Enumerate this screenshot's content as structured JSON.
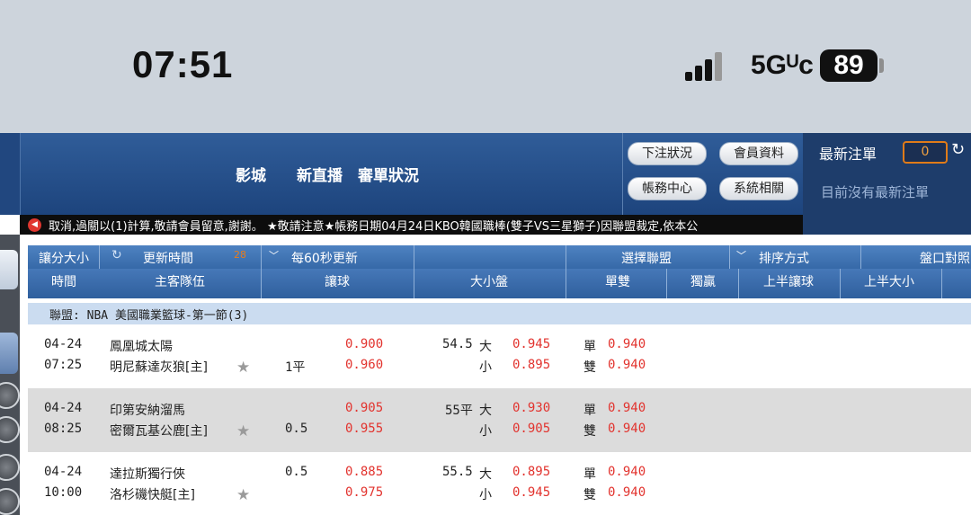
{
  "status": {
    "time": "07:51",
    "network": "5Gᵁc",
    "battery": "89"
  },
  "header": {
    "nav": [
      "影城",
      "新直播",
      "審單狀況"
    ],
    "buttons": {
      "bet_status": "下注狀況",
      "member_info": "會員資料",
      "account_center": "帳務中心",
      "system": "系統相關"
    }
  },
  "latest_bets": {
    "title": "最新注單",
    "count": "0",
    "empty": "目前沒有最新注單"
  },
  "ticker": "取消,過關以(1)計算,敬請會員留意,謝謝。 ★敬請注意★帳務日期04月24日KBO韓國職棒(雙子VS三星獅子)因聯盟裁定,依本公",
  "toolbar": {
    "handicap_ou": "讓分大小",
    "update_time": "更新時間",
    "auto_update": "每60秒更新",
    "select_league": "選擇聯盟",
    "sort": "排序方式",
    "odds_type": "盤口對照"
  },
  "columns": [
    "時間",
    "主客隊伍",
    "讓球",
    "大小盤",
    "單雙",
    "獨贏",
    "上半讓球",
    "上半大小"
  ],
  "league": "聯盟: NBA 美國職業籃球-第一節(3)",
  "matches": [
    {
      "date": "04-24",
      "time": "07:25",
      "team1": "鳳凰城太陽",
      "team2": "明尼蘇達灰狼[主]",
      "hdp_line1": "",
      "hdp_line2": "1平",
      "hdp_odds1": "0.900",
      "hdp_odds2": "0.960",
      "ou_line": "54.5",
      "over": "大",
      "under": "小",
      "ou_odds1": "0.945",
      "ou_odds2": "0.895",
      "odd": "單",
      "even": "雙",
      "oe_odds1": "0.940",
      "oe_odds2": "0.940"
    },
    {
      "date": "04-24",
      "time": "08:25",
      "team1": "印第安納溜馬",
      "team2": "密爾瓦基公鹿[主]",
      "hdp_line1": "",
      "hdp_line2": "0.5",
      "hdp_odds1": "0.905",
      "hdp_odds2": "0.955",
      "ou_line": "55平",
      "over": "大",
      "under": "小",
      "ou_odds1": "0.930",
      "ou_odds2": "0.905",
      "odd": "單",
      "even": "雙",
      "oe_odds1": "0.940",
      "oe_odds2": "0.940"
    },
    {
      "date": "04-24",
      "time": "10:00",
      "team1": "達拉斯獨行俠",
      "team2": "洛杉磯快艇[主]",
      "hdp_line1": "0.5",
      "hdp_line2": "",
      "hdp_odds1": "0.885",
      "hdp_odds2": "0.975",
      "ou_line": "55.5",
      "over": "大",
      "under": "小",
      "ou_odds1": "0.895",
      "ou_odds2": "0.945",
      "odd": "單",
      "even": "雙",
      "oe_odds1": "0.940",
      "oe_odds2": "0.940"
    }
  ]
}
